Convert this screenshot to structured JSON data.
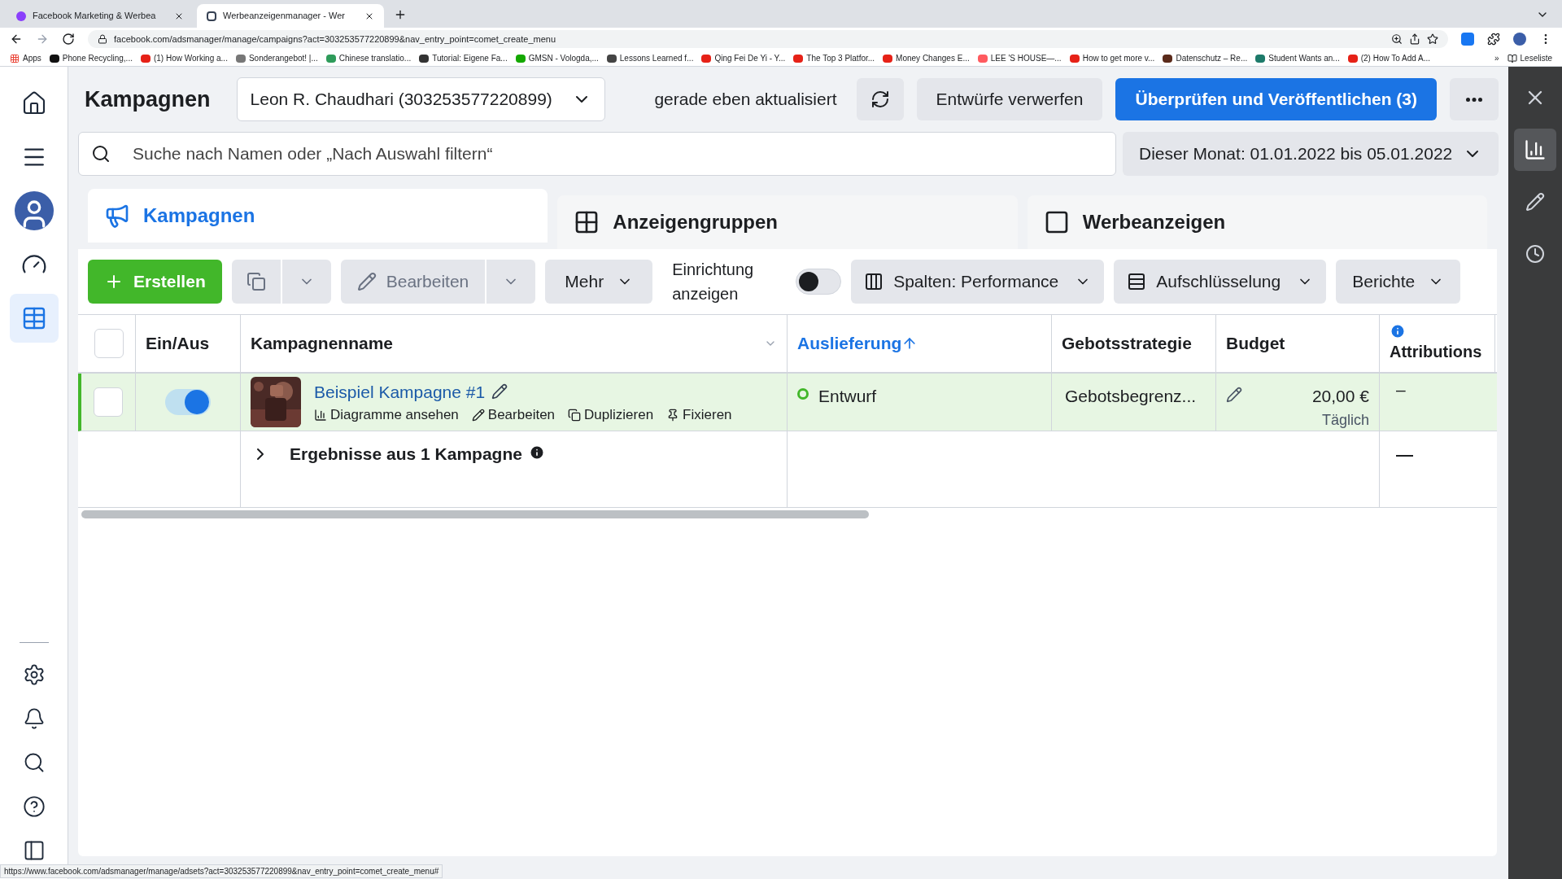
{
  "browser": {
    "tabs": [
      {
        "title": "Facebook Marketing & Werbea",
        "selected": false,
        "kind": "circle"
      },
      {
        "title": "Werbeanzeigenmanager - Wer",
        "selected": true,
        "kind": "square"
      }
    ],
    "address": "facebook.com/adsmanager/manage/campaigns?act=303253577220899&nav_entry_point=comet_create_menu",
    "apps": "Apps",
    "bookmarks": [
      {
        "label": "Phone Recycling,...",
        "color": "#111111"
      },
      {
        "label": "(1) How Working a...",
        "color": "#e62117"
      },
      {
        "label": "Sonderangebot! |...",
        "color": "#777777"
      },
      {
        "label": "Chinese translatio...",
        "color": "#2e9b5a"
      },
      {
        "label": "Tutorial: Eigene Fa...",
        "color": "#333333"
      },
      {
        "label": "GMSN - Vologda,...",
        "color": "#14a800"
      },
      {
        "label": "Lessons Learned f...",
        "color": "#444444"
      },
      {
        "label": "Qing Fei De Yi - Y...",
        "color": "#e62117"
      },
      {
        "label": "The Top 3 Platfor...",
        "color": "#e62117"
      },
      {
        "label": "Money Changes E...",
        "color": "#e62117"
      },
      {
        "label": "LEE 'S HOUSE—...",
        "color": "#ff5a5f"
      },
      {
        "label": "How to get more v...",
        "color": "#e62117"
      },
      {
        "label": "Datenschutz – Re...",
        "color": "#5a2a1a"
      },
      {
        "label": "Student Wants an...",
        "color": "#1d7a6a"
      },
      {
        "label": "(2) How To Add A...",
        "color": "#e62117"
      }
    ],
    "more": "»",
    "reading_list": "Leseliste",
    "status_url": "https://www.facebook.com/adsmanager/manage/adsets?act=303253577220899&nav_entry_point=comet_create_menu#"
  },
  "left_nav": [
    {
      "kind": "home",
      "selected": false
    },
    {
      "kind": "menu",
      "selected": false
    },
    {
      "kind": "avatar",
      "selected": false
    },
    {
      "kind": "gauge",
      "selected": false
    },
    {
      "kind": "table",
      "selected": true
    }
  ],
  "left_nav_bottom": [
    {
      "kind": "settings"
    },
    {
      "kind": "bell"
    },
    {
      "kind": "search"
    },
    {
      "kind": "help"
    },
    {
      "kind": "panel"
    }
  ],
  "right_panel": [
    {
      "kind": "close",
      "selected": false
    },
    {
      "kind": "chart",
      "selected": true
    },
    {
      "kind": "pencil",
      "selected": false
    },
    {
      "kind": "clock",
      "selected": false
    }
  ],
  "header": {
    "title": "Kampagnen",
    "account": "Leon R. Chaudhari (303253577220899)",
    "status": "gerade eben aktualisiert",
    "discard": "Entwürfe verwerfen",
    "publish": "Überprüfen und Veröffentlichen (3)"
  },
  "search": {
    "placeholder": "Suche nach Namen oder „Nach Auswahl filtern“"
  },
  "date_range": "Dieser Monat: 01.01.2022 bis 05.01.2022",
  "level_tabs": [
    {
      "label": "Kampagnen",
      "selected": true,
      "kind": "campaign"
    },
    {
      "label": "Anzeigengruppen",
      "selected": false,
      "kind": "grid"
    },
    {
      "label": "Werbeanzeigen",
      "selected": false,
      "kind": "ad"
    }
  ],
  "toolbar": {
    "create": "Erstellen",
    "edit": "Bearbeiten",
    "more": "Mehr",
    "setup_label": "Einrichtung anzeigen",
    "setup_on": false,
    "columns": "Spalten: Performance",
    "breakdown": "Aufschlüsselung",
    "reports": "Berichte"
  },
  "table": {
    "select_all_checked": false,
    "columns": [
      {
        "kind": "checkbox"
      },
      {
        "kind": "text",
        "label": "Ein/Aus"
      },
      {
        "kind": "menu",
        "label": "Kampagnenname"
      },
      {
        "kind": "sorted",
        "label": "Auslieferung"
      },
      {
        "kind": "text",
        "label": "Gebotsstrategie"
      },
      {
        "kind": "text",
        "label": "Budget"
      },
      {
        "kind": "info",
        "label": "Attributions"
      }
    ],
    "rows": [
      {
        "checked": false,
        "on": true,
        "highlighted": true,
        "name": "Beispiel Kampagne #1",
        "actions": [
          {
            "kind": "chart",
            "label": "Diagramme ansehen"
          },
          {
            "kind": "edit",
            "label": "Bearbeiten"
          },
          {
            "kind": "copy",
            "label": "Duplizieren"
          },
          {
            "kind": "pin",
            "label": "Fixieren"
          }
        ],
        "delivery": "Entwurf",
        "bid": "Gebotsbegrenz...",
        "budget": "20,00 €",
        "budget_period": "Täglich",
        "attribution": "–"
      }
    ],
    "summary": {
      "label": "Ergebnisse aus 1 Kampagne",
      "attribution": "—"
    }
  }
}
